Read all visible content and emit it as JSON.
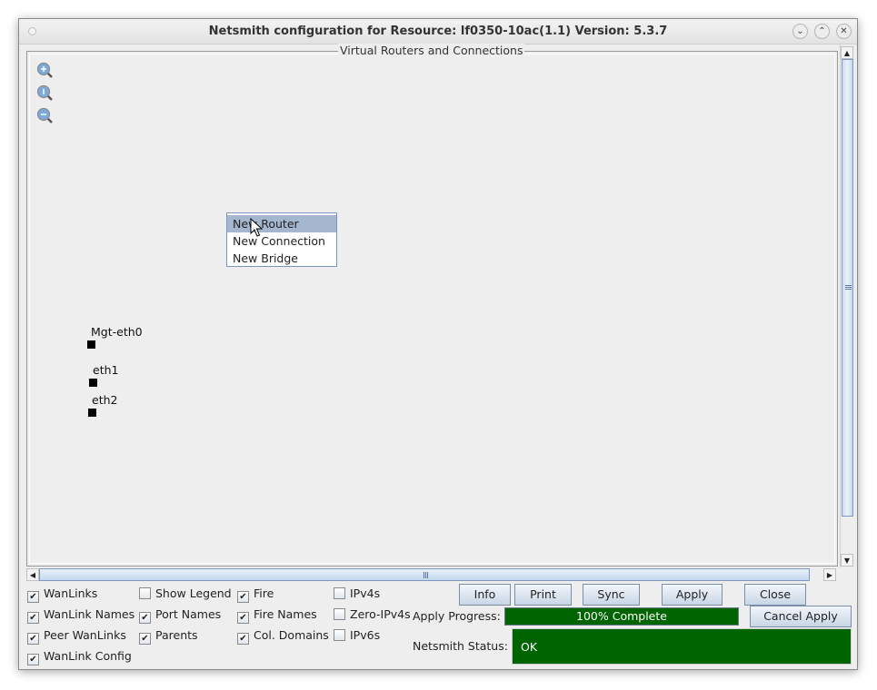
{
  "window": {
    "title": "Netsmith configuration for Resource:  lf0350-10ac(1.1)  Version: 5.3.7",
    "buttons": [
      "minimize",
      "maximize",
      "close"
    ]
  },
  "canvas": {
    "group_title": "Virtual Routers and Connections",
    "zoom_tools": [
      {
        "icon": "zoom-in-icon"
      },
      {
        "icon": "zoom-reset-icon"
      },
      {
        "icon": "zoom-out-icon"
      }
    ],
    "ports": [
      {
        "label": "Mgt-eth0"
      },
      {
        "label": "eth1"
      },
      {
        "label": "eth2"
      }
    ],
    "context_menu": {
      "items": [
        {
          "label": "New Router",
          "selected": true
        },
        {
          "label": "New Connection",
          "selected": false
        },
        {
          "label": "New Bridge",
          "selected": false
        }
      ]
    }
  },
  "options": {
    "checkboxes": [
      {
        "label": "WanLinks",
        "checked": true
      },
      {
        "label": "WanLink Names",
        "checked": true
      },
      {
        "label": "Peer WanLinks",
        "checked": true
      },
      {
        "label": "WanLink Config",
        "checked": true
      },
      {
        "label": "Show Legend",
        "checked": false
      },
      {
        "label": "Port Names",
        "checked": true
      },
      {
        "label": "Parents",
        "checked": true
      },
      {
        "label": "Fire",
        "checked": true
      },
      {
        "label": "Fire Names",
        "checked": true
      },
      {
        "label": "Col. Domains",
        "checked": true
      },
      {
        "label": "IPv4s",
        "checked": false
      },
      {
        "label": "Zero-IPv4s",
        "checked": false
      },
      {
        "label": "IPv6s",
        "checked": false
      }
    ]
  },
  "actions": {
    "info": "Info",
    "print": "Print",
    "sync": "Sync",
    "apply": "Apply",
    "close": "Close",
    "cancel_apply": "Cancel Apply"
  },
  "progress": {
    "label": "Apply Progress:",
    "text": "100% Complete",
    "value_percent": 100,
    "color": "#006400"
  },
  "status": {
    "label": "Netsmith Status:",
    "value": "OK",
    "color": "#006400"
  }
}
